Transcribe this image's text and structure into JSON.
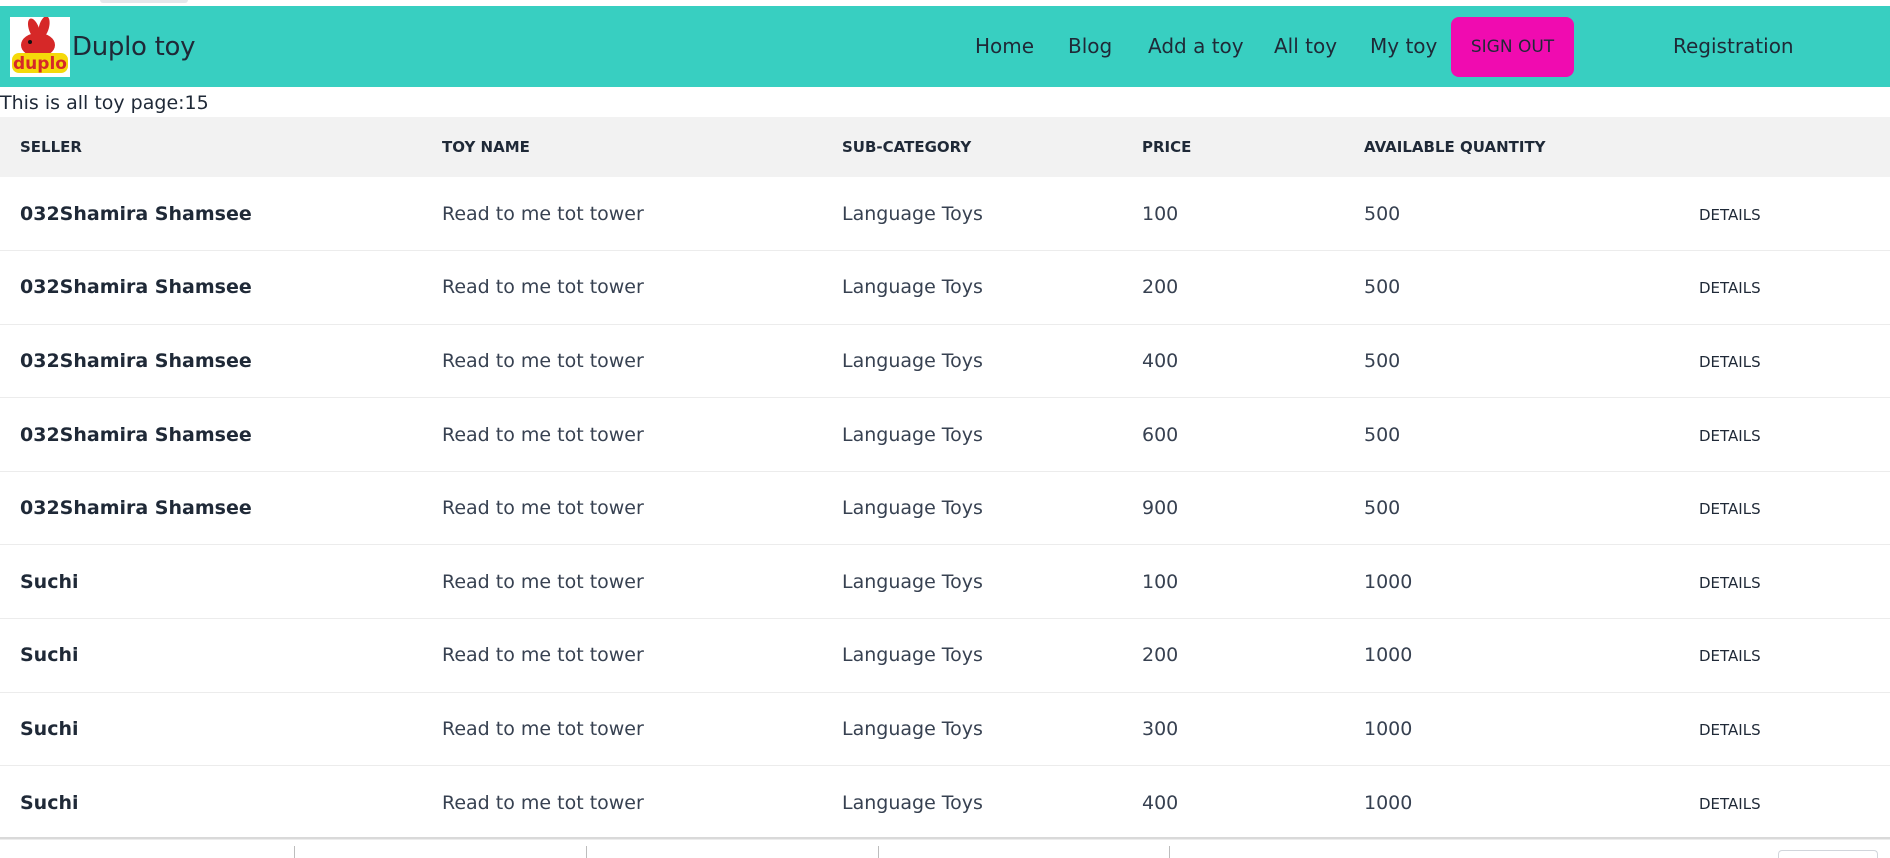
{
  "brand": {
    "name": "Duplo toy",
    "logo_text": "duplo",
    "logo_icon": "rabbit-icon"
  },
  "nav": {
    "links": [
      {
        "label": "Home"
      },
      {
        "label": "Blog"
      },
      {
        "label": "Add a toy"
      },
      {
        "label": "All toy"
      },
      {
        "label": "My toy"
      }
    ],
    "signout_label": "Sign out",
    "registration_label": "Registration"
  },
  "colors": {
    "navbar": "#38cfc1",
    "signout": "#f00bb0",
    "header_row": "#f2f2f2"
  },
  "caption": "This is all toy page:15",
  "table": {
    "headers": [
      "Seller",
      "Toy Name",
      "Sub-category",
      "Price",
      "Available Quantity",
      ""
    ],
    "details_label": "Details",
    "rows": [
      {
        "seller": "032Shamira Shamsee",
        "toy": "Read to me tot tower",
        "sub": "Language Toys",
        "price": "100",
        "qty": "500"
      },
      {
        "seller": "032Shamira Shamsee",
        "toy": "Read to me tot tower",
        "sub": "Language Toys",
        "price": "200",
        "qty": "500"
      },
      {
        "seller": "032Shamira Shamsee",
        "toy": "Read to me tot tower",
        "sub": "Language Toys",
        "price": "400",
        "qty": "500"
      },
      {
        "seller": "032Shamira Shamsee",
        "toy": "Read to me tot tower",
        "sub": "Language Toys",
        "price": "600",
        "qty": "500"
      },
      {
        "seller": "032Shamira Shamsee",
        "toy": "Read to me tot tower",
        "sub": "Language Toys",
        "price": "900",
        "qty": "500"
      },
      {
        "seller": "Suchi",
        "toy": "Read to me tot tower",
        "sub": "Language Toys",
        "price": "100",
        "qty": "1000"
      },
      {
        "seller": "Suchi",
        "toy": "Read to me tot tower",
        "sub": "Language Toys",
        "price": "200",
        "qty": "1000"
      },
      {
        "seller": "Suchi",
        "toy": "Read to me tot tower",
        "sub": "Language Toys",
        "price": "300",
        "qty": "1000"
      },
      {
        "seller": "Suchi",
        "toy": "Read to me tot tower",
        "sub": "Language Toys",
        "price": "400",
        "qty": "1000"
      }
    ]
  }
}
